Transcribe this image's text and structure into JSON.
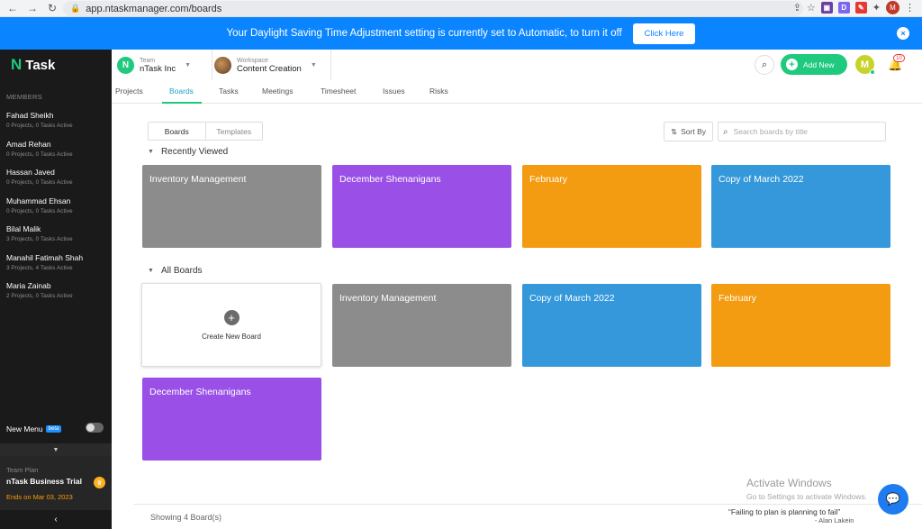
{
  "browser": {
    "url": "app.ntaskmanager.com/boards",
    "profile_initial": "M"
  },
  "banner": {
    "message": "Your Daylight Saving Time Adjustment setting is currently set to Automatic, to turn it off",
    "button": "Click Here",
    "close": "×"
  },
  "sidebar": {
    "logo_mark": "N",
    "logo_text": "Task",
    "members_label": "MEMBERS",
    "members": [
      {
        "name": "Fahad Sheikh",
        "sub": "0 Projects, 0 Tasks Active"
      },
      {
        "name": "Amad Rehan",
        "sub": "0 Projects, 0 Tasks Active"
      },
      {
        "name": "Hassan Javed",
        "sub": "0 Projects, 0 Tasks Active"
      },
      {
        "name": "Muhammad Ehsan",
        "sub": "0 Projects, 0 Tasks Active"
      },
      {
        "name": "Bilal Malik",
        "sub": "3 Projects, 0 Tasks Active"
      },
      {
        "name": "Manahil Fatimah Shah",
        "sub": "3 Projects, 4 Tasks Active"
      },
      {
        "name": "Maria Zainab",
        "sub": "2 Projects, 0 Tasks Active"
      }
    ],
    "new_menu": "New Menu",
    "beta": "beta",
    "plan_label": "Team Plan",
    "plan_name": "nTask Business Trial",
    "plan_ends": "Ends on Mar 03, 2023"
  },
  "header": {
    "team_label": "Team",
    "team_name": "nTask Inc",
    "workspace_label": "Workspace",
    "workspace_name": "Content Creation",
    "add_new": "Add New",
    "user_initial": "M",
    "notification_count": "10"
  },
  "tabs": [
    "Projects",
    "Boards",
    "Tasks",
    "Meetings",
    "Timesheet",
    "Issues",
    "Risks"
  ],
  "active_tab": "Boards",
  "toolbar": {
    "seg_boards": "Boards",
    "seg_templates": "Templates",
    "sort_by": "Sort By",
    "search_placeholder": "Search boards by title"
  },
  "recently_viewed": {
    "title": "Recently Viewed",
    "boards": [
      {
        "name": "Inventory Management",
        "color": "#8c8c8c"
      },
      {
        "name": "December Shenanigans",
        "color": "#9a50e6"
      },
      {
        "name": "February",
        "color": "#f39c12"
      },
      {
        "name": "Copy of March 2022",
        "color": "#3498db"
      }
    ]
  },
  "all_boards": {
    "title": "All Boards",
    "create_label": "Create New Board",
    "boards": [
      {
        "name": "Inventory Management",
        "color": "#8c8c8c"
      },
      {
        "name": "Copy of March 2022",
        "color": "#3498db"
      },
      {
        "name": "February",
        "color": "#f39c12"
      },
      {
        "name": "December Shenanigans",
        "color": "#9a50e6"
      }
    ]
  },
  "footer": {
    "showing": "Showing 4 Board(s)",
    "quote": "“Failing to plan is planning to fail”",
    "quote_author": "- Alan Lakein"
  },
  "watermark": {
    "title": "Activate Windows",
    "sub": "Go to Settings to activate Windows."
  },
  "colors": {
    "accent_green": "#1fc97e",
    "banner_blue": "#0a85ff"
  }
}
